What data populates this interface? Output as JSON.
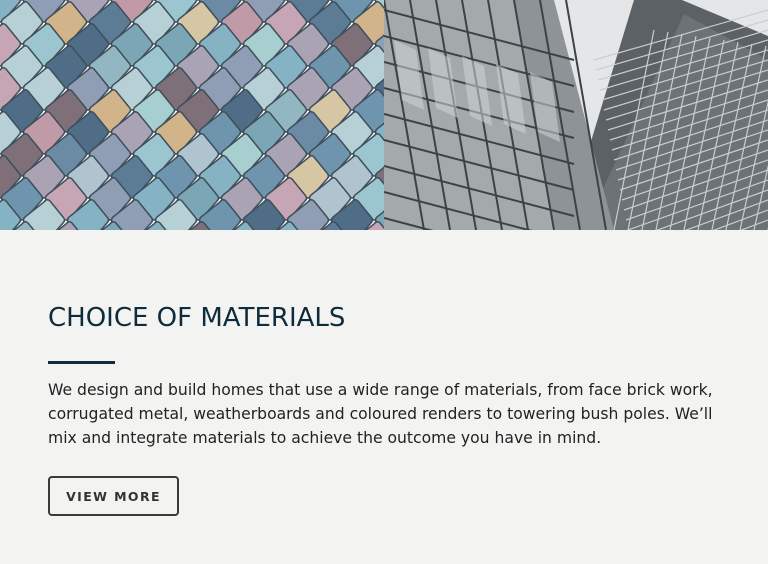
{
  "hero": {
    "left_image": "colored-tiles-photo",
    "right_image": "building-facade-photo"
  },
  "section": {
    "title": "CHOICE OF MATERIALS",
    "body": "We design and build homes that use a wide range of materials, from face brick work, corrugated metal, weatherboards and coloured renders to towering bush poles. We’ll mix and integrate materials to achieve the outcome you have in mind.",
    "button_label": "VIEW MORE"
  },
  "colors": {
    "heading": "#0f2c3c",
    "background": "#f3f3f2",
    "button_border": "#3a3a3a"
  }
}
